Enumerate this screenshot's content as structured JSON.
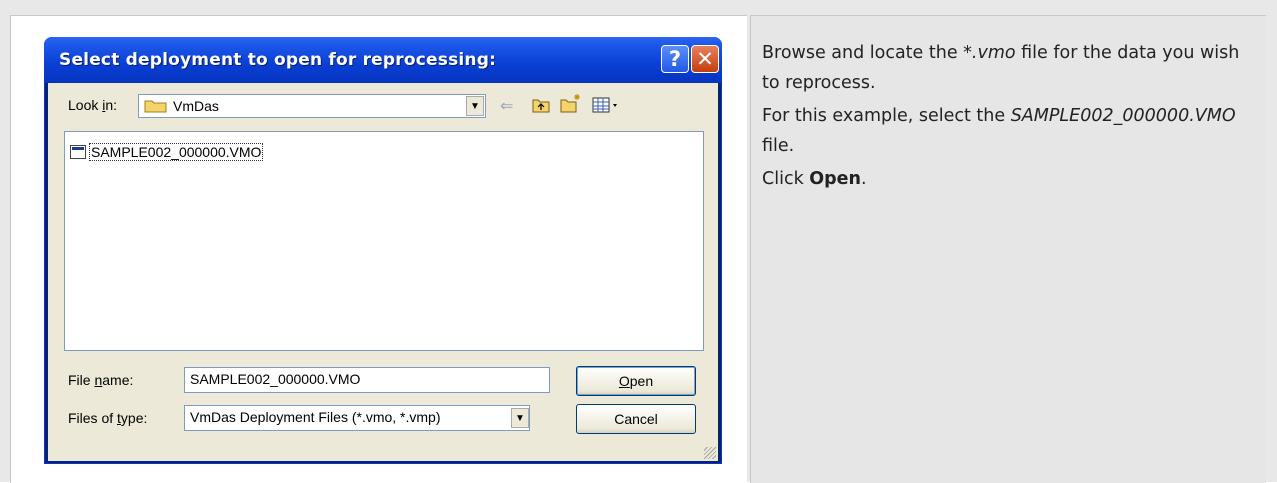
{
  "dialog": {
    "title": "Select deployment to open for reprocessing:",
    "help_label": "?",
    "close_label": "✕",
    "look_in_label": "Look in:",
    "look_in_value": "VmDas",
    "files": [
      "SAMPLE002_000000.VMO"
    ],
    "file_name_label": "File name:",
    "file_name_value": "SAMPLE002_000000.VMO",
    "files_of_type_label": "Files of type:",
    "files_of_type_value": "VmDas Deployment Files (*.vmo, *.vmp)",
    "open_label": "Open",
    "cancel_label": "Cancel",
    "icons": [
      "folder-icon",
      "back-arrow-icon",
      "up-folder-icon",
      "new-folder-icon",
      "view-menu-icon",
      "file-icon"
    ]
  },
  "instructions": {
    "p1_pre": "Browse and locate the ",
    "p1_em": "*.vmo",
    "p1_post": " file for the data you wish to reprocess.",
    "p2_pre": "For this example, select the ",
    "p2_em": "SAMPLE002_000000.VMO",
    "p2_post": " file.",
    "p3_pre": "Click ",
    "p3_strong": "Open",
    "p3_post": "."
  },
  "colors": {
    "titlebar": "#0a3fd4",
    "dialog_face": "#ece9d8",
    "close_button": "#c43c10",
    "right_cell": "#e6e6e6"
  }
}
